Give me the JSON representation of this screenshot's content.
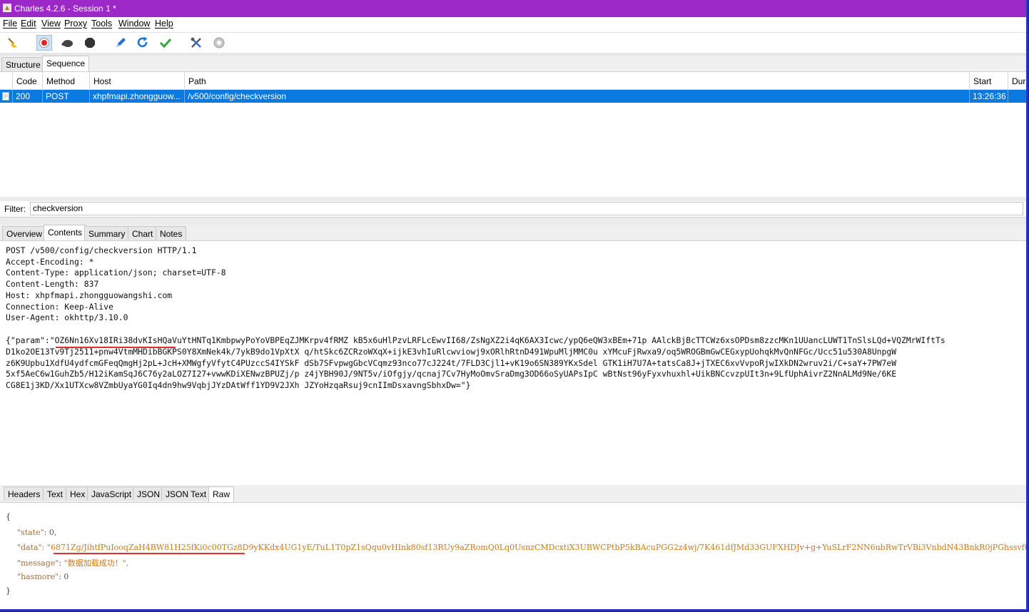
{
  "window": {
    "title": "Charles 4.2.6 - Session 1 *"
  },
  "menu": [
    "File",
    "Edit",
    "View",
    "Proxy",
    "Tools",
    "Window",
    "Help"
  ],
  "toolbar_icons": [
    "broom-icon",
    "record-icon",
    "throttle-turtle-icon",
    "breakpoint-hexagon-icon",
    "compose-pen-icon",
    "repeat-refresh-icon",
    "validate-check-icon",
    "tools-icon",
    "settings-gear-icon"
  ],
  "top_tabs": [
    "Structure",
    "Sequence"
  ],
  "columns": {
    "code": "Code",
    "method": "Method",
    "host": "Host",
    "path": "Path",
    "start": "Start",
    "dur": "Dur"
  },
  "row": {
    "code": "200",
    "method": "POST",
    "host": "xhpfmapi.zhongguow...",
    "path": "/v500/config/checkversion",
    "start": "13:26:36"
  },
  "filter": {
    "label": "Filter:",
    "value": "checkversion"
  },
  "detail_tabs": [
    "Overview",
    "Contents",
    "Summary",
    "Chart",
    "Notes"
  ],
  "request": {
    "lines": [
      "POST /v500/config/checkversion HTTP/1.1",
      "Accept-Encoding: *",
      "Content-Type: application/json; charset=UTF-8",
      "Content-Length: 837",
      "Host: xhpfmapi.zhongguowangshi.com",
      "Connection: Keep-Alive",
      "User-Agent: okhttp/3.10.0",
      "",
      "{\"param\":\"OZ6Nn16Xv18IRi38dvKIsHQaVuYtHNTq1KmbpwyPoYoVBPEqZJMKrpv4fRMZ kB5x6uHlPzvLRFLcEwvII68/ZsNgXZ2i4qK6AX3Icwc/ypQ6eQW3xBEm+71p AAlckBjBcTTCWz6xsOPDsm8zzcMKn1UUancLUWT1TnSlsLQd+VQZMrWIftTs",
      "D1ko2OE13Tv9Tj2511+pnw4VtmMHDibBGKPS0Y8XmNek4k/7ykB9do1VpXtX q/htSkc6ZCRzoWXqX+ijkE3vhIuRlcwviowj9xORlhRtnD491WpuMljMMC0u xYMcuFjRwxa9/oq5WROGBmGwCEGxypUohqkMvQnNFGc/Ucc51u530A8UnpgW",
      "z6K9Upbu1XdfU4ydfcmGFeqQmgHj2pL+JcH+XMWgfyVfytC4PUzccS4IYSkF dSb7SFvpwgGbcVCqmz93nco77cJ224t/7FLD3Cjl1+vK19o6SN389YKxSdel GTK1iH7U7A+tatsCa8J+jTXEC6xvVvpoRjwIXkDN2wruv2i/C+saY+7PW7eW",
      "5xf5AeC6w1GuhZb5/H12iKamSqJ6C76y2aLOZ7I27+vwwKDiXENwzBPUZj/p z4jYBH90J/9NT5v/iOfgjy/qcnaj7Cv7HyMoOmvSraDmg3OD66oSyUAPsIpC wBtNst96yFyxvhuxhl+UikBNCcvzpUIt3n+9LfUphAivrZ2NnALMd9Ne/6KE",
      "CG8E1j3KD/Xx1UTXcw8VZmbUyaYG0Iq4dn9hw9VqbjJYzDAtWff1YD9V2JXh JZYoHzqaRsuj9cnIImDsxavngSbhxDw=\"}"
    ]
  },
  "body_tabs": [
    "Headers",
    "Text",
    "Hex",
    "JavaScript",
    "JSON",
    "JSON Text",
    "Raw"
  ],
  "response": {
    "open": "{",
    "close": "}",
    "state_key": "\"state\"",
    "state_val": ": 0,",
    "data_key": "\"data\"",
    "data_val": ": \"6871Zg/JihtfPuIooqZaH4BW81H25fKi0c00TGz8D9yKKdx4UG1yE/TuL1T0pZ1sQqu0vHInk80sf13RUy9aZRomQ0Lq0UsnzCMDcxtiX3UBWCPtbP5kBAcuPGG2z4wj/7K461dfJMd33GUFXHDJv+g+YuSLrF2NN6ubRwTrVBi3VnbdN43BnkR0jPGhssvf0v1+DHPRvL10WDr+C",
    "message_key": "\"message\"",
    "message_val": "\"数据加载成功！\",",
    "hasmore_key": "\"hasmore\"",
    "hasmore_val": ": 0"
  }
}
